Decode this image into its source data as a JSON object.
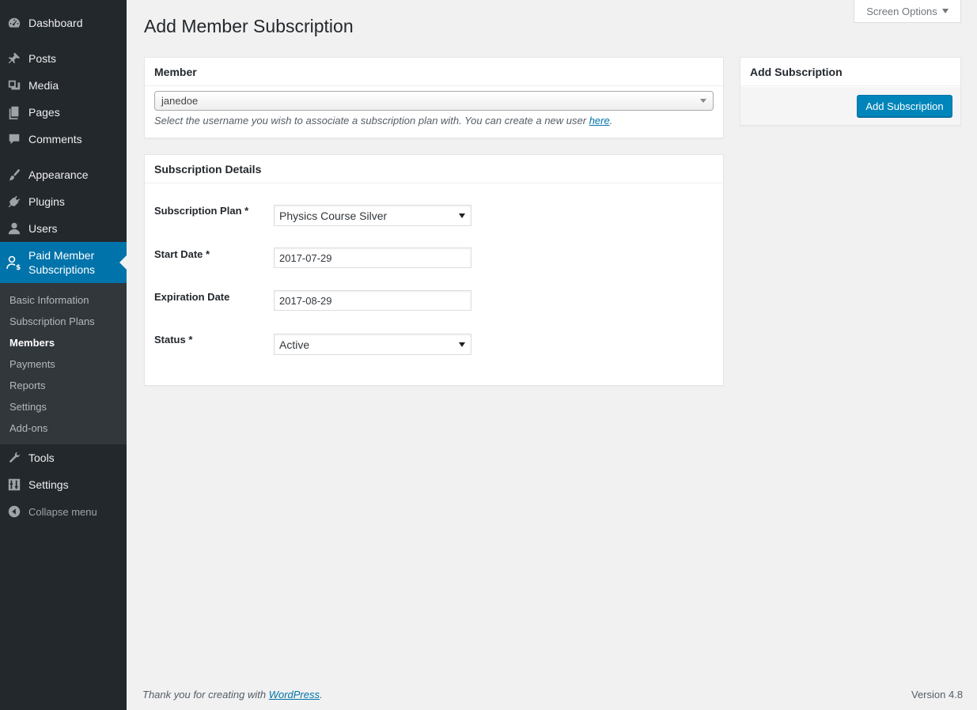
{
  "sidebar": {
    "items": [
      {
        "label": "Dashboard",
        "icon": "dashboard-icon"
      },
      {
        "label": "Posts",
        "icon": "pushpin-icon"
      },
      {
        "label": "Media",
        "icon": "media-icon"
      },
      {
        "label": "Pages",
        "icon": "pages-icon"
      },
      {
        "label": "Comments",
        "icon": "comment-icon"
      },
      {
        "label": "Appearance",
        "icon": "brush-icon"
      },
      {
        "label": "Plugins",
        "icon": "plug-icon"
      },
      {
        "label": "Users",
        "icon": "user-icon"
      }
    ],
    "active": {
      "label": "Paid Member Subscriptions",
      "icon": "member-dollar-icon"
    },
    "submenu": [
      "Basic Information",
      "Subscription Plans",
      "Members",
      "Payments",
      "Reports",
      "Settings",
      "Add-ons"
    ],
    "submenu_current": "Members",
    "after": [
      {
        "label": "Tools",
        "icon": "wrench-icon"
      },
      {
        "label": "Settings",
        "icon": "sliders-icon"
      }
    ],
    "collapse": "Collapse menu"
  },
  "screen_options": "Screen Options",
  "page_title": "Add Member Subscription",
  "member_panel": {
    "title": "Member",
    "selected": "janedoe",
    "desc_prefix": "Select the username you wish to associate a subscription plan with. You can create a new user ",
    "desc_link": "here",
    "desc_suffix": "."
  },
  "details_panel": {
    "title": "Subscription Details",
    "plan_label": "Subscription Plan *",
    "plan_value": "Physics Course Silver",
    "start_label": "Start Date *",
    "start_value": "2017-07-29",
    "expiration_label": "Expiration Date",
    "expiration_value": "2017-08-29",
    "status_label": "Status *",
    "status_value": "Active"
  },
  "side_panel": {
    "title": "Add Subscription",
    "button": "Add Subscription"
  },
  "footer": {
    "thanks_prefix": "Thank you for creating with ",
    "thanks_link": "WordPress",
    "thanks_suffix": ".",
    "version": "Version 4.8"
  },
  "colors": {
    "sidebar_bg": "#23282d",
    "active_bg": "#0073aa",
    "submenu_bg": "#32373c",
    "button_bg": "#0085ba"
  }
}
